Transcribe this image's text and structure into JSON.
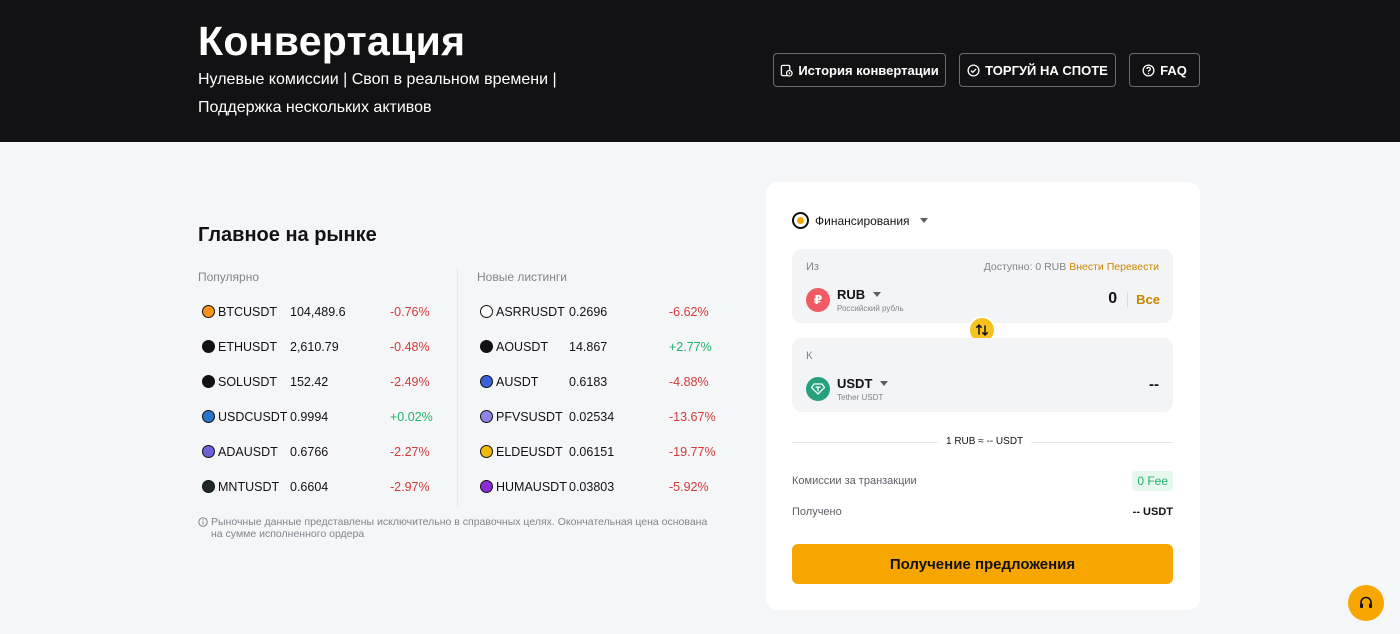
{
  "header": {
    "title": "Конвертация",
    "subtitle": "Нулевые комиссии | Своп в реальном времени | Поддержка нескольких активов",
    "buttons": {
      "history": "История конвертации",
      "spot": "ТОРГУЙ НА СПОТЕ",
      "faq": "FAQ"
    }
  },
  "market": {
    "title": "Главное на рынке",
    "popular_label": "Популярно",
    "new_label": "Новые листинги",
    "popular": [
      {
        "symbol": "BTCUSDT",
        "price": "104,489.6",
        "change": "-0.76%",
        "dir": "neg",
        "color": "#f7931a"
      },
      {
        "symbol": "ETHUSDT",
        "price": "2,610.79",
        "change": "-0.48%",
        "dir": "neg",
        "color": "#121214"
      },
      {
        "symbol": "SOLUSDT",
        "price": "152.42",
        "change": "-2.49%",
        "dir": "neg",
        "color": "#121214"
      },
      {
        "symbol": "USDCUSDT",
        "price": "0.9994",
        "change": "+0.02%",
        "dir": "pos",
        "color": "#2775ca"
      },
      {
        "symbol": "ADAUSDT",
        "price": "0.6766",
        "change": "-2.27%",
        "dir": "neg",
        "color": "#6c63d9"
      },
      {
        "symbol": "MNTUSDT",
        "price": "0.6604",
        "change": "-2.97%",
        "dir": "neg",
        "color": "#1e2a2a"
      }
    ],
    "new_listings": [
      {
        "symbol": "ASRRUSDT",
        "price": "0.2696",
        "change": "-6.62%",
        "dir": "neg",
        "color": "#ffffff"
      },
      {
        "symbol": "AOUSDT",
        "price": "14.867",
        "change": "+2.77%",
        "dir": "pos",
        "color": "#121214"
      },
      {
        "symbol": "AUSDT",
        "price": "0.6183",
        "change": "-4.88%",
        "dir": "neg",
        "color": "#3a62d7"
      },
      {
        "symbol": "PFVSUSDT",
        "price": "0.02534",
        "change": "-13.67%",
        "dir": "neg",
        "color": "#8d86e8"
      },
      {
        "symbol": "ELDEUSDT",
        "price": "0.06151",
        "change": "-19.77%",
        "dir": "neg",
        "color": "#f0b90b"
      },
      {
        "symbol": "HUMAUSDT",
        "price": "0.03803",
        "change": "-5.92%",
        "dir": "neg",
        "color": "#8e2bd9"
      }
    ],
    "disclaimer": "Рыночные данные представлены исключительно в справочных целях. Окончательная цена основана на сумме исполненного ордера"
  },
  "convert": {
    "account": "Финансирования",
    "from": {
      "label": "Из",
      "available": "Доступно: 0 RUB",
      "deposit": "Внести",
      "transfer": "Перевести",
      "code": "RUB",
      "name": "Российский рубль",
      "icon": "₽",
      "amount": "0",
      "max_label": "Все"
    },
    "to": {
      "label": "К",
      "code": "USDT",
      "name": "Tether USDT",
      "amount": "--"
    },
    "rate": "1 RUB ≈ -- USDT",
    "fee_label": "Комиссии за транзакции",
    "fee_value": "0 Fee",
    "received_label": "Получено",
    "received_value": "-- USDT",
    "quote_button": "Получение предложения"
  },
  "colors": {
    "accent": "#f7a600",
    "header_bg": "#121214",
    "negative": "#d33a3a",
    "positive": "#20b26c"
  }
}
